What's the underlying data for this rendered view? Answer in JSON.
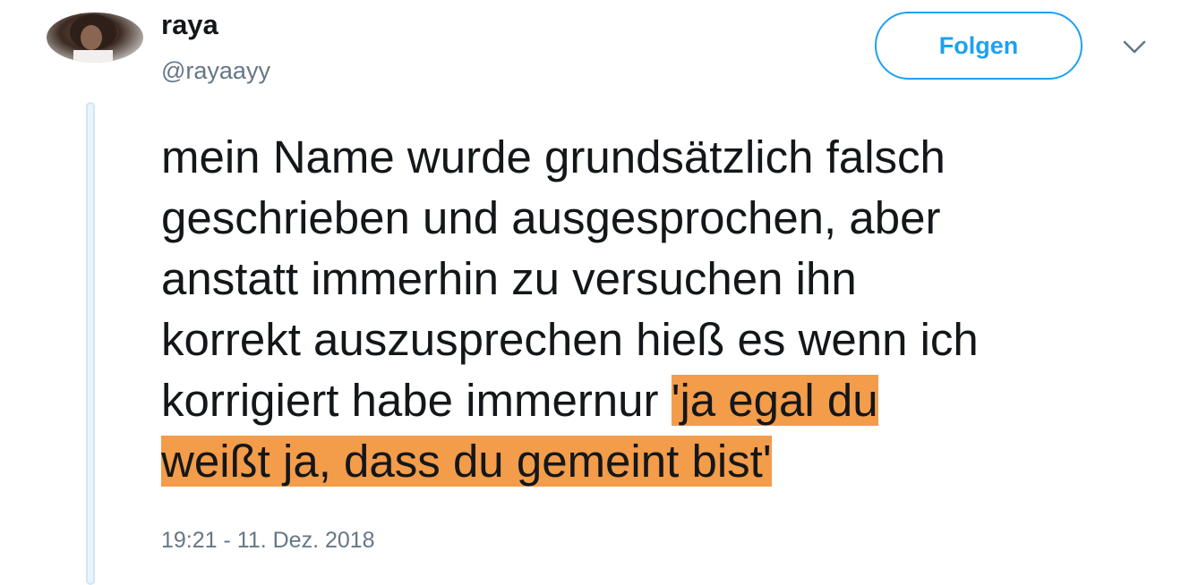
{
  "user": {
    "display_name": "raya",
    "handle": "@rayaayy"
  },
  "actions": {
    "follow_label": "Folgen",
    "menu_icon": "chevron-down-icon"
  },
  "tweet": {
    "lines": [
      "mein Name wurde grundsätzlich falsch",
      "geschrieben und ausgesprochen, aber",
      "anstatt immerhin zu versuchen ihn",
      "korrekt auszusprechen hieß es wenn ich"
    ],
    "line5_prefix": "korrigiert habe immernur ",
    "highlight_part1": "'ja egal du",
    "highlight_part2": "weißt ja, dass du gemeint bist'",
    "highlight_color": "#f39c4a",
    "timestamp": "19:21 - 11. Dez. 2018"
  },
  "colors": {
    "accent": "#1da1f2",
    "secondary_text": "#657786",
    "thread_line": "#cfe6f7"
  }
}
